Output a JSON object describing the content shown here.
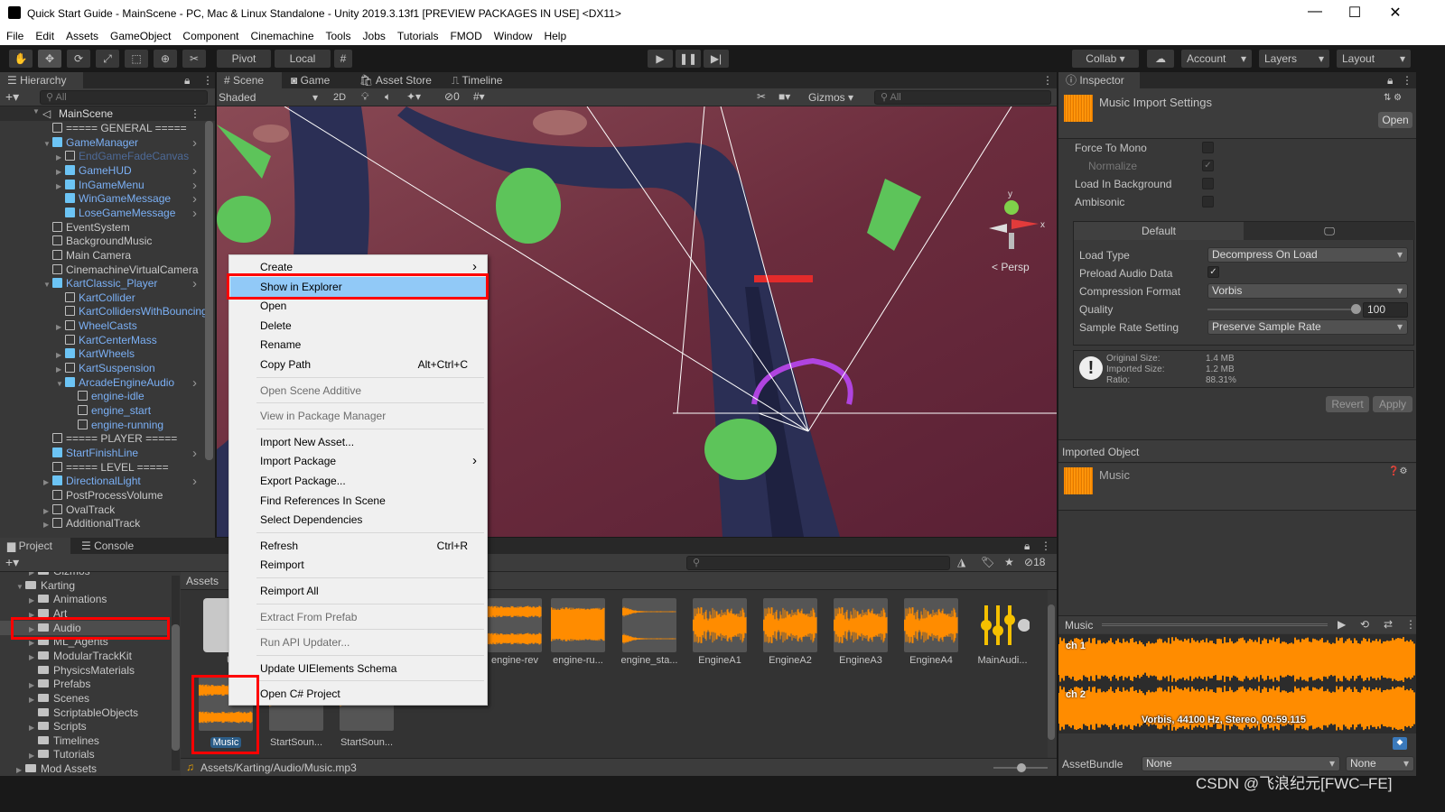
{
  "window": {
    "title": "Quick Start Guide - MainScene - PC, Mac & Linux Standalone - Unity 2019.3.13f1 [PREVIEW PACKAGES IN USE] <DX11>",
    "minimize": "—",
    "maximize": "☐",
    "close": "✕"
  },
  "menu": [
    "File",
    "Edit",
    "Assets",
    "GameObject",
    "Component",
    "Cinemachine",
    "Tools",
    "Jobs",
    "Tutorials",
    "FMOD",
    "Window",
    "Help"
  ],
  "toolbar": {
    "pivot": "Pivot",
    "local": "Local",
    "collab": "Collab ▾",
    "account": "Account",
    "layers": "Layers",
    "layout": "Layout"
  },
  "hierarchy": {
    "title": "Hierarchy",
    "search_placeholder": "All",
    "scene": "MainScene",
    "items": [
      {
        "label": "===== GENERAL =====",
        "depth": 0,
        "style": "normal",
        "prefab": false,
        "arrow": ""
      },
      {
        "label": "GameManager",
        "depth": 0,
        "style": "blue",
        "prefab": true,
        "arrow": "open",
        "more": true
      },
      {
        "label": "EndGameFadeCanvas",
        "depth": 1,
        "style": "dim",
        "prefab": false,
        "arrow": "closed"
      },
      {
        "label": "GameHUD",
        "depth": 1,
        "style": "blue",
        "prefab": true,
        "arrow": "closed",
        "more": true
      },
      {
        "label": "InGameMenu",
        "depth": 1,
        "style": "blue",
        "prefab": true,
        "arrow": "closed",
        "more": true
      },
      {
        "label": "WinGameMessage",
        "depth": 1,
        "style": "blue",
        "prefab": true,
        "arrow": "",
        "more": true
      },
      {
        "label": "LoseGameMessage",
        "depth": 1,
        "style": "blue",
        "prefab": true,
        "arrow": "",
        "more": true
      },
      {
        "label": "EventSystem",
        "depth": 0,
        "style": "normal",
        "prefab": false,
        "arrow": ""
      },
      {
        "label": "BackgroundMusic",
        "depth": 0,
        "style": "normal",
        "prefab": false,
        "arrow": ""
      },
      {
        "label": "Main Camera",
        "depth": 0,
        "style": "normal",
        "prefab": false,
        "arrow": ""
      },
      {
        "label": "CinemachineVirtualCamera",
        "depth": 0,
        "style": "normal",
        "prefab": false,
        "arrow": ""
      },
      {
        "label": "KartClassic_Player",
        "depth": 0,
        "style": "blue",
        "prefab": true,
        "arrow": "open",
        "more": true
      },
      {
        "label": "KartCollider",
        "depth": 1,
        "style": "blue",
        "prefab": false,
        "arrow": ""
      },
      {
        "label": "KartCollidersWithBouncing",
        "depth": 1,
        "style": "blue",
        "prefab": false,
        "arrow": ""
      },
      {
        "label": "WheelCasts",
        "depth": 1,
        "style": "blue",
        "prefab": false,
        "arrow": "closed"
      },
      {
        "label": "KartCenterMass",
        "depth": 1,
        "style": "blue",
        "prefab": false,
        "arrow": ""
      },
      {
        "label": "KartWheels",
        "depth": 1,
        "style": "blue",
        "prefab": true,
        "arrow": "closed"
      },
      {
        "label": "KartSuspension",
        "depth": 1,
        "style": "blue",
        "prefab": false,
        "arrow": "closed"
      },
      {
        "label": "ArcadeEngineAudio",
        "depth": 1,
        "style": "blue",
        "prefab": true,
        "arrow": "open",
        "more": true
      },
      {
        "label": "engine-idle",
        "depth": 2,
        "style": "blue",
        "prefab": false,
        "arrow": ""
      },
      {
        "label": "engine_start",
        "depth": 2,
        "style": "blue",
        "prefab": false,
        "arrow": ""
      },
      {
        "label": "engine-running",
        "depth": 2,
        "style": "blue",
        "prefab": false,
        "arrow": ""
      },
      {
        "label": "===== PLAYER =====",
        "depth": 0,
        "style": "normal",
        "prefab": false,
        "arrow": ""
      },
      {
        "label": "StartFinishLine",
        "depth": 0,
        "style": "blue",
        "prefab": true,
        "arrow": "",
        "more": true
      },
      {
        "label": "===== LEVEL =====",
        "depth": 0,
        "style": "normal",
        "prefab": false,
        "arrow": ""
      },
      {
        "label": "DirectionalLight",
        "depth": 0,
        "style": "blue",
        "prefab": true,
        "arrow": "closed",
        "more": true
      },
      {
        "label": "PostProcessVolume",
        "depth": 0,
        "style": "normal",
        "prefab": false,
        "arrow": ""
      },
      {
        "label": "OvalTrack",
        "depth": 0,
        "style": "normal",
        "prefab": false,
        "arrow": "closed"
      },
      {
        "label": "AdditionalTrack",
        "depth": 0,
        "style": "normal",
        "prefab": false,
        "arrow": "closed"
      }
    ]
  },
  "scene": {
    "tabs": [
      "Scene",
      "Game",
      "Asset Store",
      "Timeline"
    ],
    "shading": "Shaded",
    "mode_2d": "2D",
    "hidden_count": "0",
    "gizmos": "Gizmos",
    "search_placeholder": "All",
    "persp": "< Persp",
    "axis_y": "y",
    "axis_x": "x"
  },
  "context_menu": [
    {
      "label": "Create",
      "submenu": true
    },
    {
      "label": "Show in Explorer",
      "highlighted": true
    },
    {
      "label": "Open"
    },
    {
      "label": "Delete"
    },
    {
      "label": "Rename"
    },
    {
      "label": "Copy Path",
      "shortcut": "Alt+Ctrl+C"
    },
    {
      "sep": true
    },
    {
      "label": "Open Scene Additive",
      "disabled": true
    },
    {
      "sep": true
    },
    {
      "label": "View in Package Manager",
      "disabled": true
    },
    {
      "sep": true
    },
    {
      "label": "Import New Asset..."
    },
    {
      "label": "Import Package",
      "submenu": true
    },
    {
      "label": "Export Package..."
    },
    {
      "label": "Find References In Scene"
    },
    {
      "label": "Select Dependencies"
    },
    {
      "sep": true
    },
    {
      "label": "Refresh",
      "shortcut": "Ctrl+R"
    },
    {
      "label": "Reimport"
    },
    {
      "sep": true
    },
    {
      "label": "Reimport All"
    },
    {
      "sep": true
    },
    {
      "label": "Extract From Prefab",
      "disabled": true
    },
    {
      "sep": true
    },
    {
      "label": "Run API Updater...",
      "disabled": true
    },
    {
      "sep": true
    },
    {
      "label": "Update UIElements Schema"
    },
    {
      "sep": true
    },
    {
      "label": "Open C# Project"
    }
  ],
  "project": {
    "tabs": [
      "Project",
      "Console"
    ],
    "hidden_count": "18",
    "breadcrumb": "Assets",
    "tree": [
      {
        "label": "Gizmos",
        "depth": 1,
        "arrow": "closed"
      },
      {
        "label": "Karting",
        "depth": 0,
        "arrow": "open",
        "open": true
      },
      {
        "label": "Animations",
        "depth": 1,
        "arrow": "closed"
      },
      {
        "label": "Art",
        "depth": 1,
        "arrow": "closed"
      },
      {
        "label": "Audio",
        "depth": 1,
        "arrow": "closed",
        "selected": true
      },
      {
        "label": "ML_Agents",
        "depth": 1,
        "arrow": "closed"
      },
      {
        "label": "ModularTrackKit",
        "depth": 1,
        "arrow": "closed"
      },
      {
        "label": "PhysicsMaterials",
        "depth": 1,
        "arrow": ""
      },
      {
        "label": "Prefabs",
        "depth": 1,
        "arrow": "closed"
      },
      {
        "label": "Scenes",
        "depth": 1,
        "arrow": "closed"
      },
      {
        "label": "ScriptableObjects",
        "depth": 1,
        "arrow": ""
      },
      {
        "label": "Scripts",
        "depth": 1,
        "arrow": "closed"
      },
      {
        "label": "Timelines",
        "depth": 1,
        "arrow": ""
      },
      {
        "label": "Tutorials",
        "depth": 1,
        "arrow": "closed"
      },
      {
        "label": "Mod Assets",
        "depth": 0,
        "arrow": "closed"
      }
    ],
    "assets_row1": [
      {
        "label": "U",
        "kind": "folder"
      },
      {
        "label": "engine-rev",
        "kind": "stereo"
      },
      {
        "label": "engine-ru...",
        "kind": "block"
      },
      {
        "label": "engine_sta...",
        "kind": "decay"
      },
      {
        "label": "EngineA1",
        "kind": "noise"
      },
      {
        "label": "EngineA2",
        "kind": "noise"
      },
      {
        "label": "EngineA3",
        "kind": "noise"
      },
      {
        "label": "EngineA4",
        "kind": "noise"
      },
      {
        "label": "MainAudi...",
        "kind": "mixer"
      }
    ],
    "assets_row2": [
      {
        "label": "Music",
        "kind": "stereo",
        "selected": true
      },
      {
        "label": "StartSoun...",
        "kind": "flat"
      },
      {
        "label": "StartSoun...",
        "kind": "flat"
      }
    ],
    "path": "Assets/Karting/Audio/Music.mp3"
  },
  "inspector": {
    "title": "Inspector",
    "asset_title": "Music Import Settings",
    "open": "Open",
    "force_to_mono": {
      "label": "Force To Mono",
      "checked": false
    },
    "normalize": {
      "label": "Normalize",
      "checked": true,
      "disabled": true
    },
    "load_in_background": {
      "label": "Load In Background",
      "checked": false
    },
    "ambisonic": {
      "label": "Ambisonic",
      "checked": false
    },
    "platform_tab": "Default",
    "load_type": {
      "label": "Load Type",
      "value": "Decompress On Load"
    },
    "preload": {
      "label": "Preload Audio Data",
      "checked": true
    },
    "compression": {
      "label": "Compression Format",
      "value": "Vorbis"
    },
    "quality": {
      "label": "Quality",
      "value": "100",
      "percent": 100
    },
    "sample_rate": {
      "label": "Sample Rate Setting",
      "value": "Preserve Sample Rate"
    },
    "info": {
      "original_label": "Original Size:",
      "original": "1.4 MB",
      "imported_label": "Imported Size:",
      "imported": "1.2 MB",
      "ratio_label": "Ratio:",
      "ratio": "88.31%"
    },
    "revert": "Revert",
    "apply": "Apply",
    "imported_object": "Imported Object",
    "object_name": "Music",
    "preview": {
      "title": "Music",
      "ch1": "ch 1",
      "ch2": "ch 2",
      "info": "Vorbis, 44100 Hz, Stereo, 00:59.115"
    },
    "asset_bundle": {
      "label": "AssetBundle",
      "value": "None",
      "variant": "None"
    }
  },
  "watermark": "CSDN @飞浪纪元[FWC–FE]",
  "colors": {
    "accent": "#3a79bb",
    "waveform": "#ff8c00",
    "highlight": "#91c9f7",
    "annotation": "#ff0000",
    "scene_ground": "#6b2c3d"
  }
}
